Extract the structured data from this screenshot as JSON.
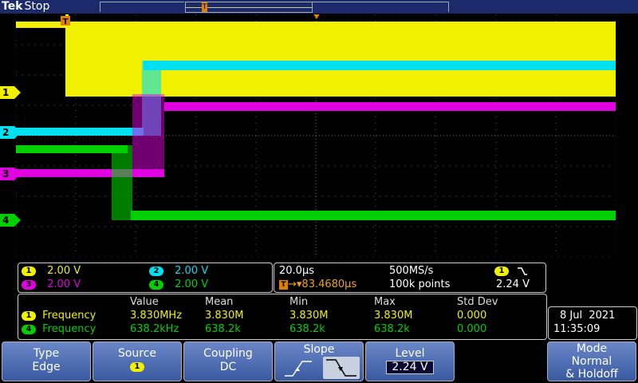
{
  "header": {
    "brand": "Tek",
    "status": "Stop",
    "trigger_marker": "T"
  },
  "channel_markers": [
    "1",
    "2",
    "3",
    "4"
  ],
  "channels": [
    {
      "id": "1",
      "scale": "2.00 V",
      "color": "#f0f000"
    },
    {
      "id": "2",
      "scale": "2.00 V",
      "color": "#00e0f0"
    },
    {
      "id": "3",
      "scale": "2.00 V",
      "color": "#e000e0"
    },
    {
      "id": "4",
      "scale": "2.00 V",
      "color": "#00d000"
    }
  ],
  "timebase": {
    "horizontal_scale": "20.0µs",
    "sample_rate": "500MS/s",
    "trigger_position_marker": "T",
    "trigger_position": "→▾83.4680µs",
    "record_length": "100k points",
    "trigger_source": "1",
    "trigger_slope_icon": "falling-edge-icon",
    "trigger_level": "2.24 V"
  },
  "measurements": {
    "headers": [
      "Value",
      "Mean",
      "Min",
      "Max",
      "Std Dev"
    ],
    "rows": [
      {
        "ch": "1",
        "name": "Frequency",
        "value": "3.830MHz",
        "mean": "3.830M",
        "min": "3.830M",
        "max": "3.830M",
        "std": "0.000"
      },
      {
        "ch": "4",
        "name": "Frequency",
        "value": "638.2kHz",
        "mean": "638.2k",
        "min": "638.2k",
        "max": "638.2k",
        "std": "0.000"
      }
    ]
  },
  "datetime": {
    "date": "8 Jul  2021",
    "time": "11:35:09"
  },
  "buttons": {
    "type": {
      "label": "Type",
      "value": "Edge"
    },
    "source": {
      "label": "Source",
      "value": "1"
    },
    "coupling": {
      "label": "Coupling",
      "value": "DC"
    },
    "slope": {
      "label": "Slope"
    },
    "level": {
      "label": "Level",
      "value": "2.24 V"
    },
    "mode": {
      "label": "Mode",
      "value1": "Normal",
      "value2": "& Holdoff"
    }
  }
}
